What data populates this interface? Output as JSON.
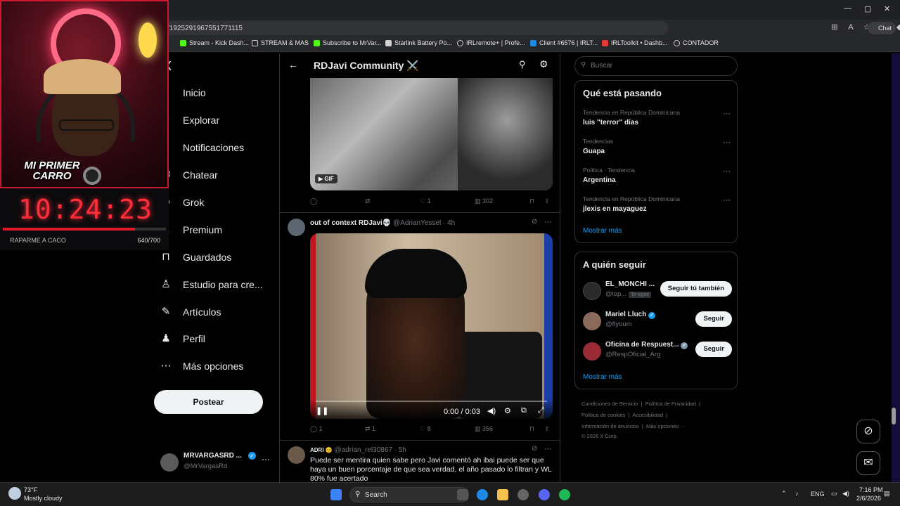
{
  "browser": {
    "url": "/1925291967551771115",
    "window_controls": [
      "—",
      "▢",
      "✕"
    ],
    "chat_label": "Chat",
    "bookmarks": [
      {
        "label": "Stream - Kick Dash...",
        "color": "#53fc18"
      },
      {
        "label": "STREAM & MAS",
        "color": "#cfcfcf"
      },
      {
        "label": "Subscribe to MrVar...",
        "color": "#53fc18"
      },
      {
        "label": "Starlink Battery Po...",
        "color": "#cfcfcf"
      },
      {
        "label": "IRLremote+ | Profe...",
        "color": "#cfcfcf"
      },
      {
        "label": "Client #6576 | IRLT...",
        "color": "#1e88e5"
      },
      {
        "label": "IRLToolkit • Dashb...",
        "color": "#e53935"
      },
      {
        "label": "CONTADOR",
        "color": "#cfcfcf"
      }
    ]
  },
  "overlay": {
    "badge": "MI PRIMER CARRO",
    "timer": "10:24:23",
    "goal_label": "RAPARME A CACO",
    "goal_count": "640/700",
    "goal_progress": 0.81
  },
  "nav": {
    "items": [
      {
        "label": "Inicio",
        "icon": "home-icon",
        "glyph": "⌂"
      },
      {
        "label": "Explorar",
        "icon": "search-icon",
        "glyph": "⚲"
      },
      {
        "label": "Notificaciones",
        "icon": "bell-icon",
        "glyph": "♪"
      },
      {
        "label": "Chatear",
        "icon": "mail-icon",
        "glyph": "✉"
      },
      {
        "label": "Grok",
        "icon": "grok-icon",
        "glyph": "⊘"
      },
      {
        "label": "Premium",
        "icon": "x-icon",
        "glyph": "X"
      },
      {
        "label": "Guardados",
        "icon": "bookmark-icon",
        "glyph": "⊓"
      },
      {
        "label": "Estudio para cre...",
        "icon": "studio-icon",
        "glyph": "♙"
      },
      {
        "label": "Artículos",
        "icon": "article-icon",
        "glyph": "✎"
      },
      {
        "label": "Perfil",
        "icon": "profile-icon",
        "glyph": "♟"
      },
      {
        "label": "Más opciones",
        "icon": "more-icon",
        "glyph": "⋯"
      }
    ],
    "post_button": "Postear",
    "account": {
      "name": "MRVARGASRD ...",
      "handle": "@MrVargasRd"
    }
  },
  "feed": {
    "title": "RDJavi Community ⚔️",
    "gif_badge": "GIF",
    "tweet1_stats": {
      "replies": "",
      "retweets": "",
      "likes": "1",
      "views": "302"
    },
    "tweet2": {
      "name": "out of context RDJavi💀",
      "handle": "@AdrianYessel",
      "time": "· 4h",
      "video_time": "0:00 / 0:03",
      "video_progress": 0.0,
      "stats": {
        "replies": "1",
        "retweets": "1",
        "likes": "8",
        "views": "356"
      }
    },
    "tweet3": {
      "name": "ADRI 😊",
      "handle": "@adrian_rel30867",
      "time": "· 5h",
      "text": "Puede ser mentira quien sabe pero Javi comentó ah ibai puede ser que haya un buen porcentaje de que sea verdad, el año pasado lo filtran y WL 80% fue acertado"
    }
  },
  "sidebar": {
    "search_placeholder": "Buscar",
    "trends_title": "Qué está pasando",
    "trends": [
      {
        "context": "Tendencia en República Dominicana",
        "name": "luis \"terror\" días"
      },
      {
        "context": "Tendencias",
        "name": "Guapa"
      },
      {
        "context": "Política · Tendencia",
        "name": "Argentina"
      },
      {
        "context": "Tendencia en República Dominicana",
        "name": "jlexis en mayaguez"
      }
    ],
    "show_more": "Mostrar más",
    "follow_title": "A quién seguir",
    "follow": [
      {
        "name": "EL_MONCHI ...",
        "handle": "@lop...",
        "tag": "Te sigue",
        "button": "Seguir tú también",
        "color": "#2a2a2a"
      },
      {
        "name": "Mariel Lluch",
        "handle": "@flyoum",
        "tag": "",
        "button": "Seguir",
        "color": "#8a6a5a"
      },
      {
        "name": "Oficina de Respuest...",
        "handle": "@RespOficial_Arg",
        "tag": "",
        "button": "Seguir",
        "color": "#9b2b35"
      }
    ],
    "follow_more": "Mostrar más",
    "footer": [
      "Condiciones de Servicio",
      "Política de Privacidad",
      "Política de cookies",
      "Accesibilidad",
      "Información de anuncios",
      "Más opciones ···",
      "© 2026 X Corp."
    ]
  },
  "taskbar": {
    "weather_temp": "73°F",
    "weather_desc": "Mostly cloudy",
    "search": "Search",
    "lang": "ENG",
    "time": "7:16 PM",
    "date": "2/6/2026"
  }
}
